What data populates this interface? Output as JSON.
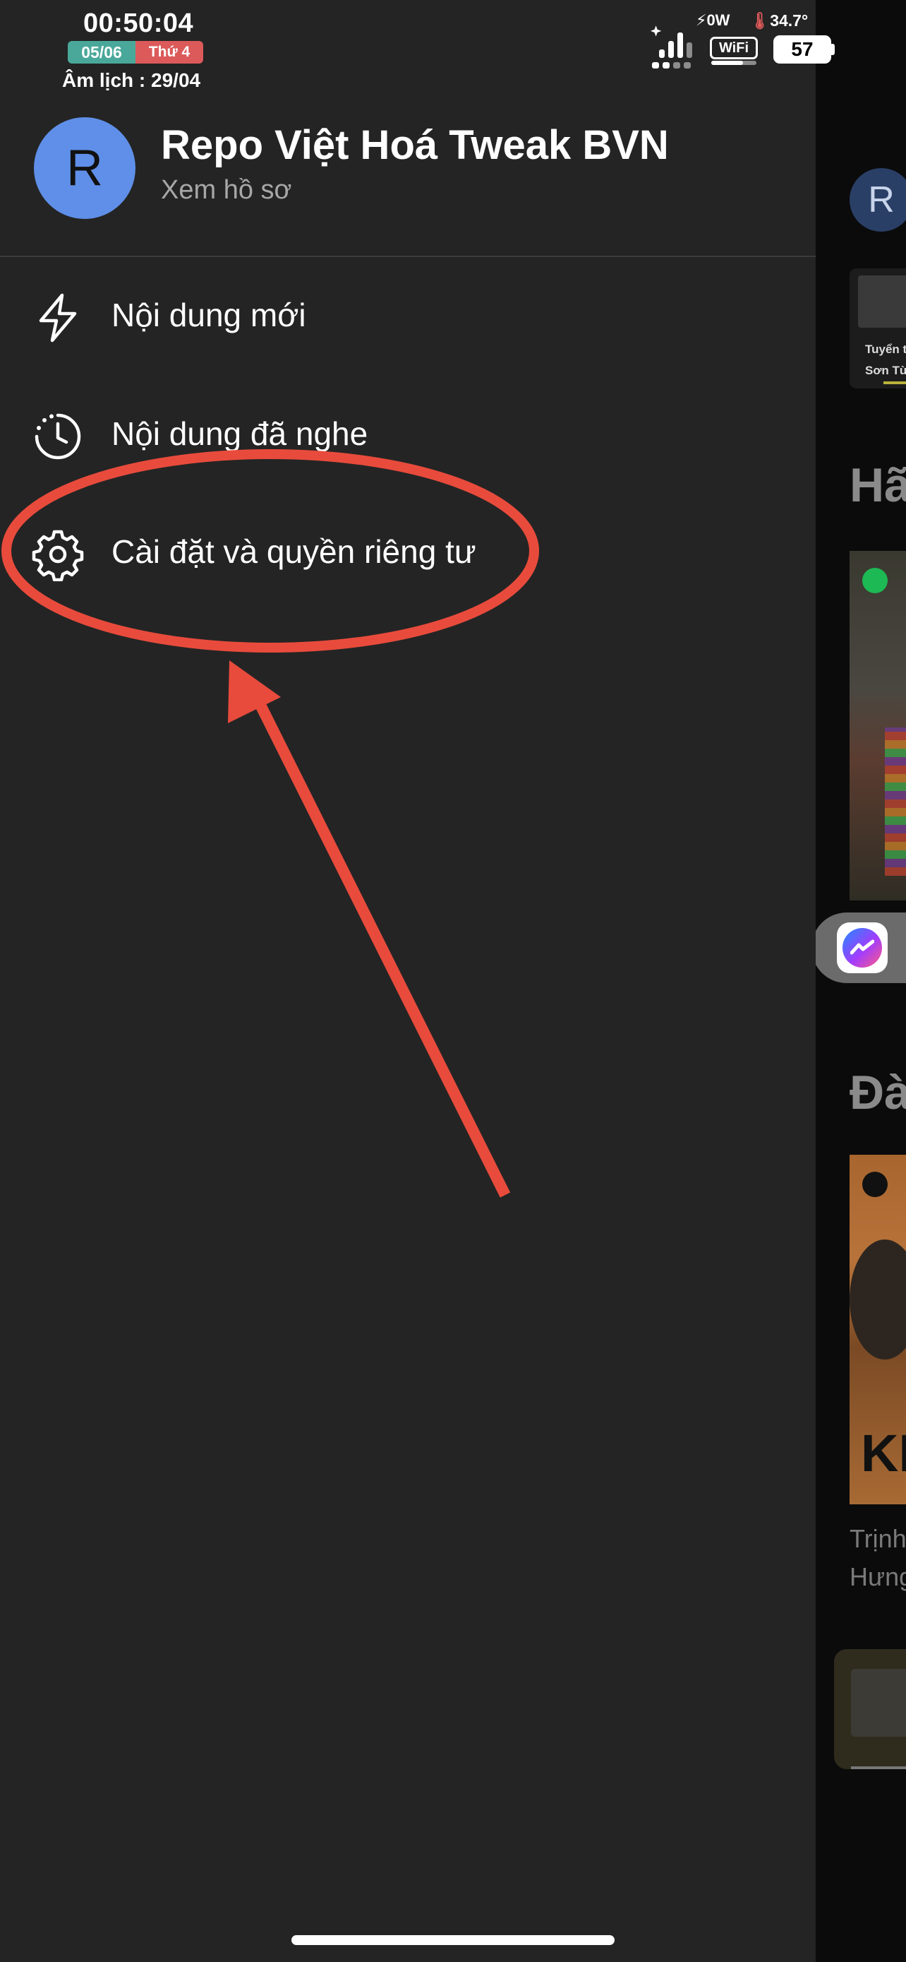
{
  "status_bar": {
    "time": "00:50:04",
    "date": "05/06",
    "weekday": "Thứ 4",
    "lunar": "Âm lịch : 29/04",
    "power": "⚡0W",
    "temperature": "34.7°",
    "wifi": "WiFi",
    "battery": "57"
  },
  "profile": {
    "initial": "R",
    "name": "Repo Việt Hoá Tweak BVN",
    "link": "Xem hồ sơ"
  },
  "menu": {
    "items": [
      {
        "icon": "lightning-icon",
        "label": "Nội dung mới"
      },
      {
        "icon": "history-clock-icon",
        "label": "Nội dung đã nghe"
      },
      {
        "icon": "gear-icon",
        "label": "Cài đặt và quyền riêng tư"
      }
    ]
  },
  "background": {
    "avatar_initial": "R",
    "card_title": "Tuyển t",
    "card_sub": "Sơn Tùn",
    "heading1": "Hã",
    "heading2": "Đà",
    "album_text": "KI",
    "sub1": "Trịnh",
    "sub2": "Hưng"
  },
  "colors": {
    "drawer_bg": "#242424",
    "avatar": "#5f8fe8",
    "annotation": "#e84b3c",
    "date_badge": "#4aa89a",
    "weekday_badge": "#dc5a5a"
  }
}
